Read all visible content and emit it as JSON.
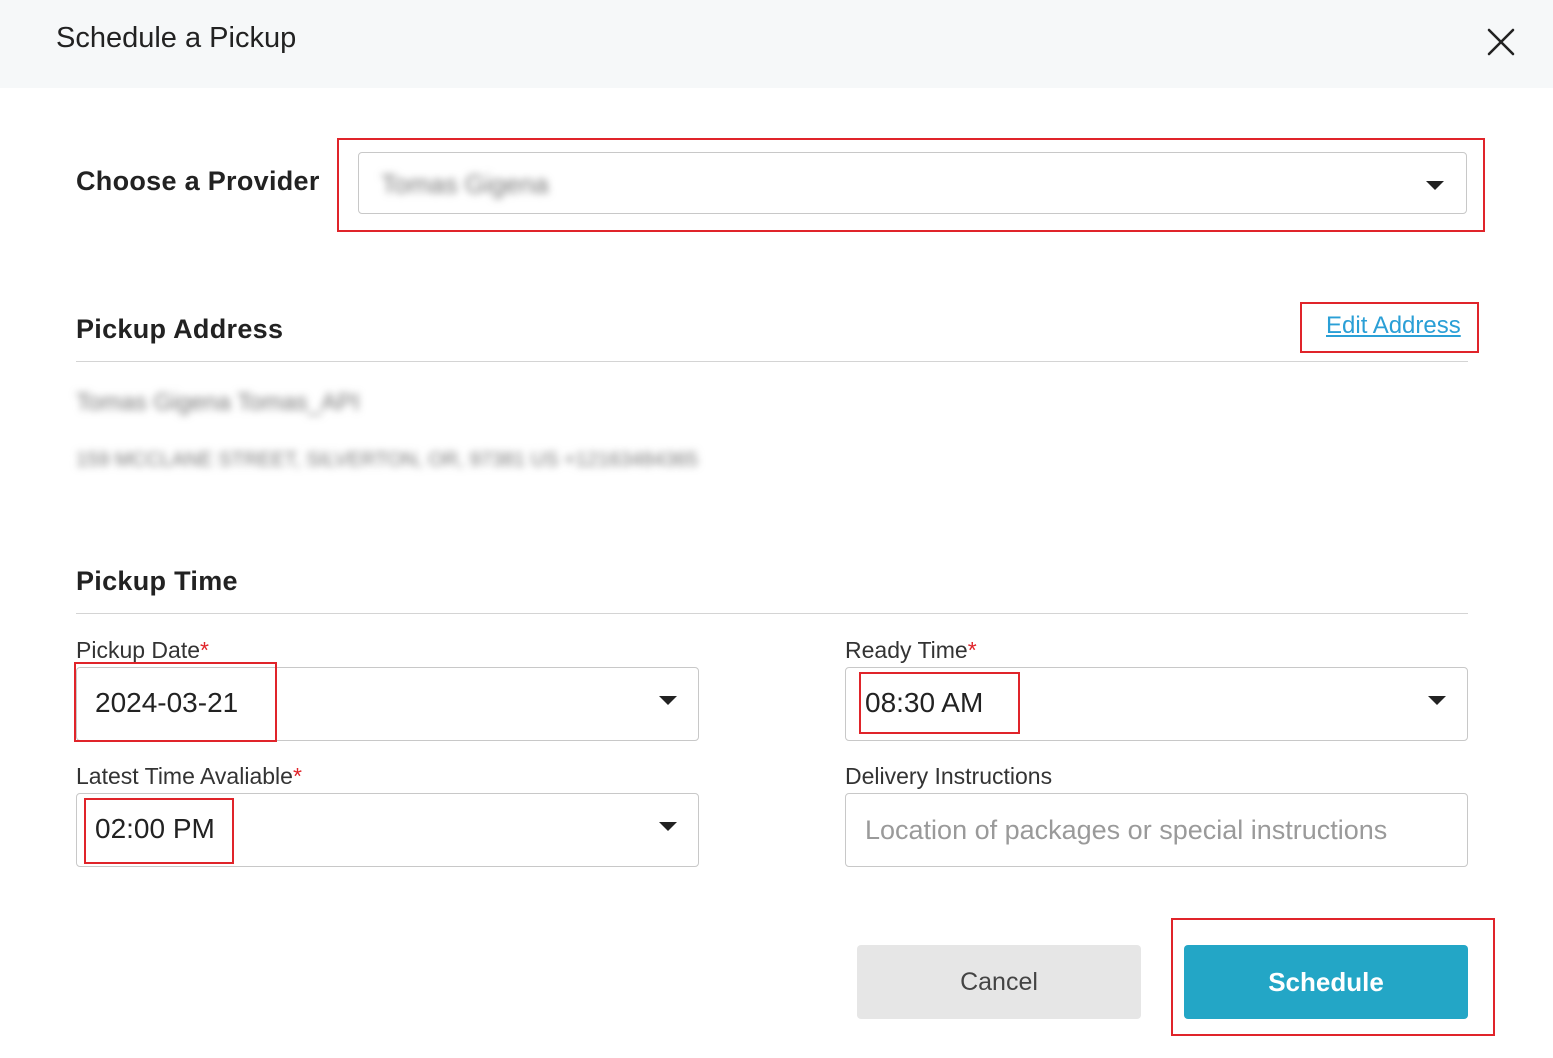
{
  "dialog": {
    "title": "Schedule a Pickup"
  },
  "provider": {
    "label": "Choose a Provider",
    "selected_value": "Tomas Gigena"
  },
  "pickup_address": {
    "title": "Pickup Address",
    "edit_link": "Edit Address",
    "line1": "Tomas Gigena   Tomas_API",
    "line2": "159 MCCLANE STREET, SILVERTON, OR, 97381 US +12163484365"
  },
  "pickup_time": {
    "title": "Pickup Time",
    "pickup_date": {
      "label": "Pickup Date",
      "required_mark": "*",
      "value": "2024-03-21"
    },
    "ready_time": {
      "label": "Ready Time",
      "required_mark": "*",
      "value": "08:30 AM"
    },
    "latest_time": {
      "label": "Latest Time Avaliable",
      "required_mark": "*",
      "value": "02:00 PM"
    },
    "delivery_instructions": {
      "label": "Delivery Instructions",
      "placeholder": "Location of packages or special instructions",
      "value": ""
    }
  },
  "actions": {
    "cancel_label": "Cancel",
    "schedule_label": "Schedule"
  },
  "colors": {
    "primary": "#23a6c6",
    "link": "#2a9fd6",
    "highlight": "#e0242a",
    "required": "#e0242a"
  },
  "icons": {
    "close": "close-icon",
    "dropdown": "chevron-down-icon"
  }
}
